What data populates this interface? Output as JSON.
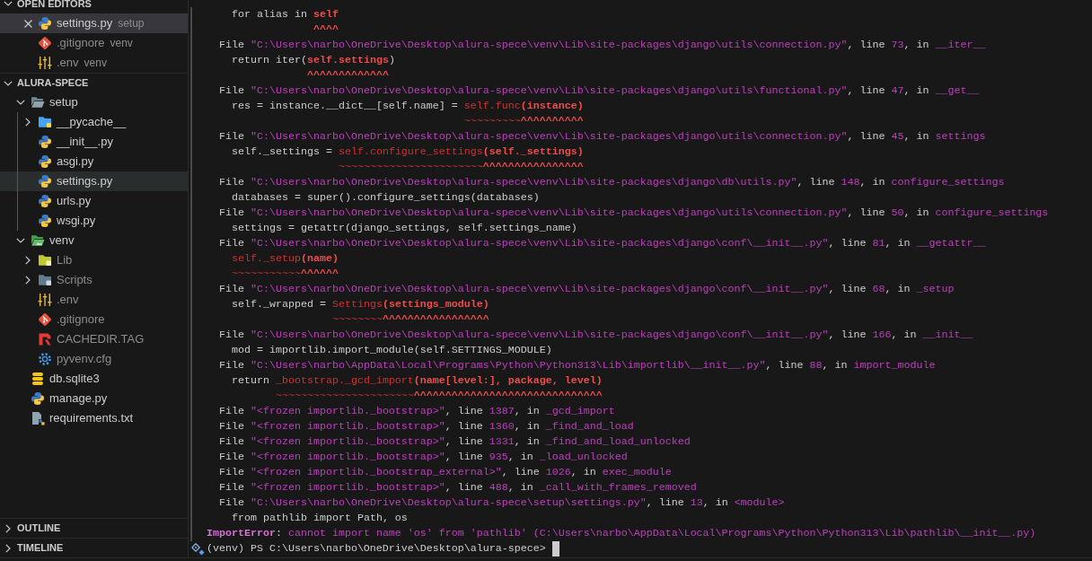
{
  "sidebar": {
    "open_editors": {
      "title": "OPEN EDITORS",
      "expanded": true,
      "items": [
        {
          "label": "settings.py",
          "description": "setup",
          "kind": "python",
          "selected": true,
          "ignored": false
        },
        {
          "label": ".gitignore",
          "description": "venv",
          "kind": "git",
          "selected": false,
          "ignored": true
        },
        {
          "label": ".env",
          "description": "venv",
          "kind": "env",
          "selected": false,
          "ignored": true
        }
      ]
    },
    "explorer": {
      "title": "ALURA-SPECE",
      "expanded": true,
      "tree": [
        {
          "label": "setup",
          "kind": "folder",
          "expanded": true,
          "selected": false,
          "ignored": false,
          "children": [
            {
              "label": "__pycache__",
              "kind": "python-folder",
              "expanded": false,
              "selected": false,
              "ignored": false
            },
            {
              "label": "__init__.py",
              "kind": "python",
              "selected": false,
              "ignored": false
            },
            {
              "label": "asgi.py",
              "kind": "python",
              "selected": false,
              "ignored": false
            },
            {
              "label": "settings.py",
              "kind": "python",
              "selected": true,
              "ignored": false
            },
            {
              "label": "urls.py",
              "kind": "python",
              "selected": false,
              "ignored": false
            },
            {
              "label": "wsgi.py",
              "kind": "python",
              "selected": false,
              "ignored": false
            }
          ]
        },
        {
          "label": "venv",
          "kind": "env-folder",
          "expanded": true,
          "selected": false,
          "ignored": false,
          "children": [
            {
              "label": "Lib",
              "kind": "lib-folder",
              "expanded": false,
              "selected": false,
              "ignored": true
            },
            {
              "label": "Scripts",
              "kind": "scripts-folder",
              "expanded": false,
              "selected": false,
              "ignored": true
            },
            {
              "label": ".env",
              "kind": "env",
              "selected": false,
              "ignored": true
            },
            {
              "label": ".gitignore",
              "kind": "git",
              "selected": false,
              "ignored": true
            },
            {
              "label": "CACHEDIR.TAG",
              "kind": "tag",
              "selected": false,
              "ignored": true
            },
            {
              "label": "pyvenv.cfg",
              "kind": "config",
              "selected": false,
              "ignored": true
            }
          ]
        },
        {
          "label": "db.sqlite3",
          "kind": "database",
          "selected": false,
          "ignored": false
        },
        {
          "label": "manage.py",
          "kind": "python",
          "selected": false,
          "ignored": false
        },
        {
          "label": "requirements.txt",
          "kind": "text",
          "selected": false,
          "ignored": false
        }
      ]
    },
    "outline": {
      "title": "OUTLINE",
      "expanded": false
    },
    "timeline": {
      "title": "TIMELINE",
      "expanded": false
    }
  },
  "terminal": {
    "lines": [
      {
        "kind": "source",
        "segments": [
          {
            "kind": "plain",
            "text": "for alias in "
          },
          {
            "kind": "highlight",
            "text": "self"
          }
        ]
      },
      {
        "kind": "marker",
        "segments": [
          {
            "kind": "highlight",
            "text": "             ^^^^"
          }
        ]
      },
      {
        "kind": "frame",
        "segments": [
          {
            "kind": "plain",
            "text": "File "
          },
          {
            "kind": "location",
            "text": "\"C:\\Users\\narbo\\OneDrive\\Desktop\\alura-spece\\venv\\Lib\\site-packages\\django\\utils\\connection.py\""
          },
          {
            "kind": "plain",
            "text": ", line "
          },
          {
            "kind": "location",
            "text": "73"
          },
          {
            "kind": "plain",
            "text": ", in "
          },
          {
            "kind": "location",
            "text": "__iter__"
          }
        ]
      },
      {
        "kind": "source",
        "segments": [
          {
            "kind": "plain",
            "text": "return iter("
          },
          {
            "kind": "highlight",
            "text": "self.settings"
          },
          {
            "kind": "plain",
            "text": ")"
          }
        ]
      },
      {
        "kind": "marker",
        "segments": [
          {
            "kind": "highlight",
            "text": "            ^^^^^^^^^^^^^"
          }
        ]
      },
      {
        "kind": "frame",
        "segments": [
          {
            "kind": "plain",
            "text": "File "
          },
          {
            "kind": "location",
            "text": "\"C:\\Users\\narbo\\OneDrive\\Desktop\\alura-spece\\venv\\Lib\\site-packages\\django\\utils\\functional.py\""
          },
          {
            "kind": "plain",
            "text": ", line "
          },
          {
            "kind": "location",
            "text": "47"
          },
          {
            "kind": "plain",
            "text": ", in "
          },
          {
            "kind": "location",
            "text": "__get__"
          }
        ]
      },
      {
        "kind": "source",
        "segments": [
          {
            "kind": "plain",
            "text": "res = instance.__dict__[self.name] = "
          },
          {
            "kind": "range",
            "text": "self.func"
          },
          {
            "kind": "highlight",
            "text": "(instance)"
          }
        ]
      },
      {
        "kind": "marker",
        "segments": [
          {
            "kind": "range",
            "text": "                                     ~~~~~~~~~"
          },
          {
            "kind": "highlight",
            "text": "^^^^^^^^^^"
          }
        ]
      },
      {
        "kind": "frame",
        "segments": [
          {
            "kind": "plain",
            "text": "File "
          },
          {
            "kind": "location",
            "text": "\"C:\\Users\\narbo\\OneDrive\\Desktop\\alura-spece\\venv\\Lib\\site-packages\\django\\utils\\connection.py\""
          },
          {
            "kind": "plain",
            "text": ", line "
          },
          {
            "kind": "location",
            "text": "45"
          },
          {
            "kind": "plain",
            "text": ", in "
          },
          {
            "kind": "location",
            "text": "settings"
          }
        ]
      },
      {
        "kind": "source",
        "segments": [
          {
            "kind": "plain",
            "text": "self._settings = "
          },
          {
            "kind": "range",
            "text": "self.configure_settings"
          },
          {
            "kind": "highlight",
            "text": "(self._settings)"
          }
        ]
      },
      {
        "kind": "marker",
        "segments": [
          {
            "kind": "range",
            "text": "                 ~~~~~~~~~~~~~~~~~~~~~~~"
          },
          {
            "kind": "highlight",
            "text": "^^^^^^^^^^^^^^^^"
          }
        ]
      },
      {
        "kind": "frame",
        "segments": [
          {
            "kind": "plain",
            "text": "File "
          },
          {
            "kind": "location",
            "text": "\"C:\\Users\\narbo\\OneDrive\\Desktop\\alura-spece\\venv\\Lib\\site-packages\\django\\db\\utils.py\""
          },
          {
            "kind": "plain",
            "text": ", line "
          },
          {
            "kind": "location",
            "text": "148"
          },
          {
            "kind": "plain",
            "text": ", in "
          },
          {
            "kind": "location",
            "text": "configure_settings"
          }
        ]
      },
      {
        "kind": "source",
        "segments": [
          {
            "kind": "plain",
            "text": "databases = super().configure_settings(databases)"
          }
        ]
      },
      {
        "kind": "frame",
        "segments": [
          {
            "kind": "plain",
            "text": "File "
          },
          {
            "kind": "location",
            "text": "\"C:\\Users\\narbo\\OneDrive\\Desktop\\alura-spece\\venv\\Lib\\site-packages\\django\\utils\\connection.py\""
          },
          {
            "kind": "plain",
            "text": ", line "
          },
          {
            "kind": "location",
            "text": "50"
          },
          {
            "kind": "plain",
            "text": ", in "
          },
          {
            "kind": "location",
            "text": "configure_settings"
          }
        ]
      },
      {
        "kind": "source",
        "segments": [
          {
            "kind": "plain",
            "text": "settings = getattr(django_settings, self.settings_name)"
          }
        ]
      },
      {
        "kind": "frame",
        "segments": [
          {
            "kind": "plain",
            "text": "File "
          },
          {
            "kind": "location",
            "text": "\"C:\\Users\\narbo\\OneDrive\\Desktop\\alura-spece\\venv\\Lib\\site-packages\\django\\conf\\__init__.py\""
          },
          {
            "kind": "plain",
            "text": ", line "
          },
          {
            "kind": "location",
            "text": "81"
          },
          {
            "kind": "plain",
            "text": ", in "
          },
          {
            "kind": "location",
            "text": "__getattr__"
          }
        ]
      },
      {
        "kind": "source",
        "segments": [
          {
            "kind": "range",
            "text": "self._setup"
          },
          {
            "kind": "highlight",
            "text": "(name)"
          }
        ]
      },
      {
        "kind": "marker",
        "segments": [
          {
            "kind": "range",
            "text": "~~~~~~~~~~~"
          },
          {
            "kind": "highlight",
            "text": "^^^^^^"
          }
        ]
      },
      {
        "kind": "frame",
        "segments": [
          {
            "kind": "plain",
            "text": "File "
          },
          {
            "kind": "location",
            "text": "\"C:\\Users\\narbo\\OneDrive\\Desktop\\alura-spece\\venv\\Lib\\site-packages\\django\\conf\\__init__.py\""
          },
          {
            "kind": "plain",
            "text": ", line "
          },
          {
            "kind": "location",
            "text": "68"
          },
          {
            "kind": "plain",
            "text": ", in "
          },
          {
            "kind": "location",
            "text": "_setup"
          }
        ]
      },
      {
        "kind": "source",
        "segments": [
          {
            "kind": "plain",
            "text": "self._wrapped = "
          },
          {
            "kind": "range",
            "text": "Settings"
          },
          {
            "kind": "highlight",
            "text": "(settings_module)"
          }
        ]
      },
      {
        "kind": "marker",
        "segments": [
          {
            "kind": "range",
            "text": "                ~~~~~~~~"
          },
          {
            "kind": "highlight",
            "text": "^^^^^^^^^^^^^^^^^"
          }
        ]
      },
      {
        "kind": "frame",
        "segments": [
          {
            "kind": "plain",
            "text": "File "
          },
          {
            "kind": "location",
            "text": "\"C:\\Users\\narbo\\OneDrive\\Desktop\\alura-spece\\venv\\Lib\\site-packages\\django\\conf\\__init__.py\""
          },
          {
            "kind": "plain",
            "text": ", line "
          },
          {
            "kind": "location",
            "text": "166"
          },
          {
            "kind": "plain",
            "text": ", in "
          },
          {
            "kind": "location",
            "text": "__init__"
          }
        ]
      },
      {
        "kind": "source",
        "segments": [
          {
            "kind": "plain",
            "text": "mod = importlib.import_module(self.SETTINGS_MODULE)"
          }
        ]
      },
      {
        "kind": "frame",
        "segments": [
          {
            "kind": "plain",
            "text": "File "
          },
          {
            "kind": "location",
            "text": "\"C:\\Users\\narbo\\AppData\\Local\\Programs\\Python\\Python313\\Lib\\importlib\\__init__.py\""
          },
          {
            "kind": "plain",
            "text": ", line "
          },
          {
            "kind": "location",
            "text": "88"
          },
          {
            "kind": "plain",
            "text": ", in "
          },
          {
            "kind": "location",
            "text": "import_module"
          }
        ]
      },
      {
        "kind": "source",
        "segments": [
          {
            "kind": "plain",
            "text": "return "
          },
          {
            "kind": "range",
            "text": "_bootstrap._gcd_import"
          },
          {
            "kind": "highlight",
            "text": "(name[level:], package, level)"
          }
        ]
      },
      {
        "kind": "marker",
        "segments": [
          {
            "kind": "range",
            "text": "       ~~~~~~~~~~~~~~~~~~~~~~"
          },
          {
            "kind": "highlight",
            "text": "^^^^^^^^^^^^^^^^^^^^^^^^^^^^^^"
          }
        ]
      },
      {
        "kind": "frame",
        "segments": [
          {
            "kind": "plain",
            "text": "File "
          },
          {
            "kind": "location",
            "text": "\"<frozen importlib._bootstrap>\""
          },
          {
            "kind": "plain",
            "text": ", line "
          },
          {
            "kind": "location",
            "text": "1387"
          },
          {
            "kind": "plain",
            "text": ", in "
          },
          {
            "kind": "location",
            "text": "_gcd_import"
          }
        ]
      },
      {
        "kind": "frame",
        "segments": [
          {
            "kind": "plain",
            "text": "File "
          },
          {
            "kind": "location",
            "text": "\"<frozen importlib._bootstrap>\""
          },
          {
            "kind": "plain",
            "text": ", line "
          },
          {
            "kind": "location",
            "text": "1360"
          },
          {
            "kind": "plain",
            "text": ", in "
          },
          {
            "kind": "location",
            "text": "_find_and_load"
          }
        ]
      },
      {
        "kind": "frame",
        "segments": [
          {
            "kind": "plain",
            "text": "File "
          },
          {
            "kind": "location",
            "text": "\"<frozen importlib._bootstrap>\""
          },
          {
            "kind": "plain",
            "text": ", line "
          },
          {
            "kind": "location",
            "text": "1331"
          },
          {
            "kind": "plain",
            "text": ", in "
          },
          {
            "kind": "location",
            "text": "_find_and_load_unlocked"
          }
        ]
      },
      {
        "kind": "frame",
        "segments": [
          {
            "kind": "plain",
            "text": "File "
          },
          {
            "kind": "location",
            "text": "\"<frozen importlib._bootstrap>\""
          },
          {
            "kind": "plain",
            "text": ", line "
          },
          {
            "kind": "location",
            "text": "935"
          },
          {
            "kind": "plain",
            "text": ", in "
          },
          {
            "kind": "location",
            "text": "_load_unlocked"
          }
        ]
      },
      {
        "kind": "frame",
        "segments": [
          {
            "kind": "plain",
            "text": "File "
          },
          {
            "kind": "location",
            "text": "\"<frozen importlib._bootstrap_external>\""
          },
          {
            "kind": "plain",
            "text": ", line "
          },
          {
            "kind": "location",
            "text": "1026"
          },
          {
            "kind": "plain",
            "text": ", in "
          },
          {
            "kind": "location",
            "text": "exec_module"
          }
        ]
      },
      {
        "kind": "frame",
        "segments": [
          {
            "kind": "plain",
            "text": "File "
          },
          {
            "kind": "location",
            "text": "\"<frozen importlib._bootstrap>\""
          },
          {
            "kind": "plain",
            "text": ", line "
          },
          {
            "kind": "location",
            "text": "488"
          },
          {
            "kind": "plain",
            "text": ", in "
          },
          {
            "kind": "location",
            "text": "_call_with_frames_removed"
          }
        ]
      },
      {
        "kind": "frame",
        "segments": [
          {
            "kind": "plain",
            "text": "File "
          },
          {
            "kind": "location",
            "text": "\"C:\\Users\\narbo\\OneDrive\\Desktop\\alura-spece\\setup\\settings.py\""
          },
          {
            "kind": "plain",
            "text": ", line "
          },
          {
            "kind": "location",
            "text": "13"
          },
          {
            "kind": "plain",
            "text": ", in "
          },
          {
            "kind": "location",
            "text": "<module>"
          }
        ]
      },
      {
        "kind": "source",
        "segments": [
          {
            "kind": "plain",
            "text": "from pathlib import Path, os"
          }
        ]
      },
      {
        "kind": "exception",
        "segments": [
          {
            "kind": "error-type",
            "text": "ImportError"
          },
          {
            "kind": "plain",
            "text": ": "
          },
          {
            "kind": "message",
            "text": "cannot import name 'os' from 'pathlib' (C:\\Users\\narbo\\AppData\\Local\\Programs\\Python\\Python313\\Lib\\pathlib\\__init__.py)"
          }
        ]
      }
    ],
    "prompt": {
      "text": "(venv) PS C:\\Users\\narbo\\OneDrive\\Desktop\\alura-spece>"
    }
  }
}
